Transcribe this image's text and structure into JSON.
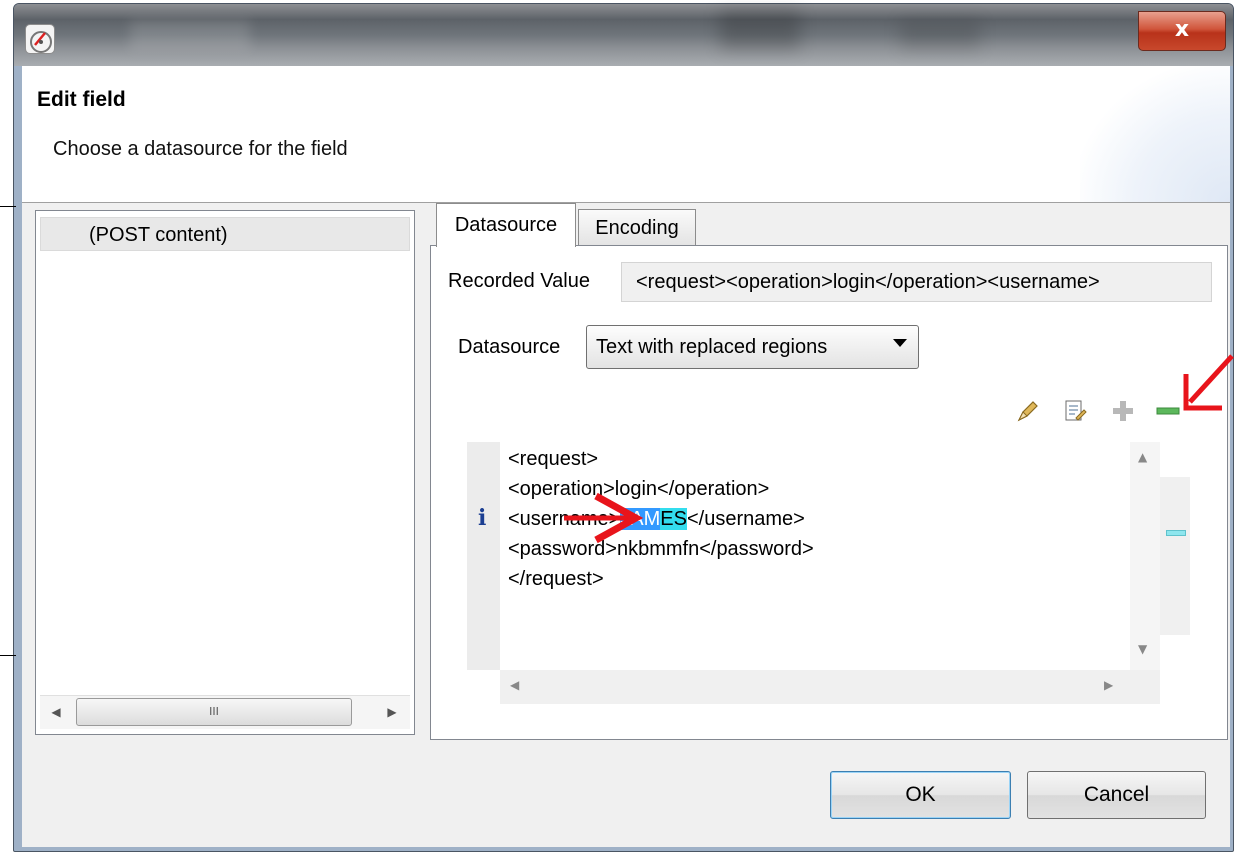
{
  "window": {
    "close_glyph": "x",
    "icon": "app-gauge-icon"
  },
  "header": {
    "title": "Edit field",
    "subtitle": "Choose a datasource for the field"
  },
  "left_list": {
    "items": [
      {
        "label": "(POST content)"
      }
    ],
    "scroll_thumb_glyph": "III"
  },
  "tabs": [
    {
      "label": "Datasource",
      "active": true
    },
    {
      "label": "Encoding",
      "active": false
    }
  ],
  "form": {
    "recorded_value_label": "Recorded Value",
    "recorded_value": "<request><operation>login</operation><username>",
    "datasource_label": "Datasource",
    "datasource_selected": "Text with replaced regions"
  },
  "toolbar": {
    "icons": [
      "pencil-icon",
      "edit-document-icon",
      "add-region-icon",
      "remove-region-icon"
    ]
  },
  "editor": {
    "info_glyph": "i",
    "lines": {
      "l1": "<request>",
      "l2": "<operation>login</operation>",
      "l3_prefix": "<username>",
      "l3_sel_blue": "JAM",
      "l3_sel_cyan": "ES",
      "l3_suffix": "</username>",
      "l4": "<password>nkbmmfn</password>",
      "l5": "</request>"
    }
  },
  "buttons": {
    "ok": "OK",
    "cancel": "Cancel"
  },
  "colors": {
    "annotation_red": "#e8141b",
    "selection_blue": "#3399ff",
    "selection_cyan": "#33ddee"
  }
}
